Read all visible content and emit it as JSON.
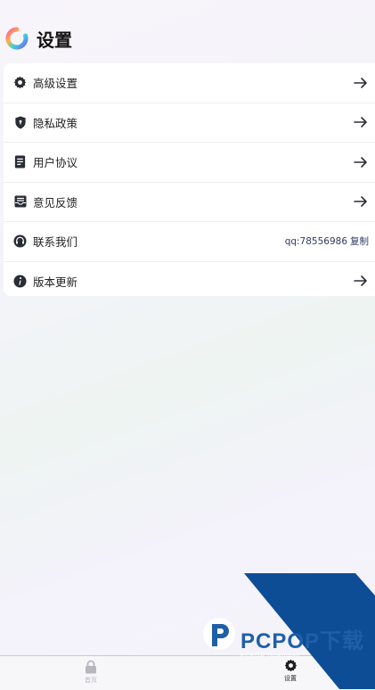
{
  "page": {
    "title": "设置"
  },
  "settings": {
    "items": [
      {
        "icon": "gear-icon",
        "label": "高级设置"
      },
      {
        "icon": "shield-icon",
        "label": "隐私政策"
      },
      {
        "icon": "document-icon",
        "label": "用户协议"
      },
      {
        "icon": "inbox-icon",
        "label": "意见反馈"
      },
      {
        "icon": "headset-icon",
        "label": "联系我们",
        "value": "qq:78556986",
        "action": "复制"
      },
      {
        "icon": "info-icon",
        "label": "版本更新"
      }
    ]
  },
  "tabbar": {
    "home_label": "首页",
    "settings_label": "设置"
  },
  "watermark": {
    "brand": "PCPOP",
    "brand_cn": "下载",
    "tagline": "PCPOP Download"
  },
  "colors": {
    "accent": "#2e3b63",
    "watermark_blue": "#0d4d96",
    "tab_active": "#1f1f1f",
    "tab_inactive": "#b7b7bd"
  }
}
